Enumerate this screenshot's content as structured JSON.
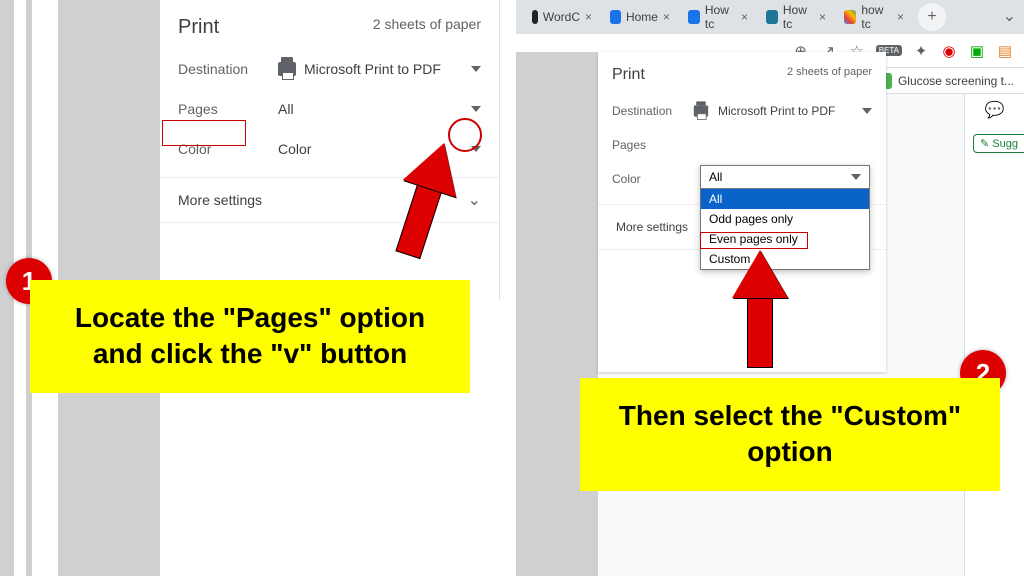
{
  "panel1": {
    "title": "Print",
    "sheets": "2 sheets of paper",
    "destination_label": "Destination",
    "destination_value": "Microsoft Print to PDF",
    "pages_label": "Pages",
    "pages_value": "All",
    "color_label": "Color",
    "color_value": "Color",
    "more_settings": "More settings"
  },
  "panel2": {
    "title": "Print",
    "sheets": "2 sheets of paper",
    "destination_label": "Destination",
    "destination_value": "Microsoft Print to PDF",
    "pages_label": "Pages",
    "pages_value": "All",
    "color_label": "Color",
    "more_settings": "More settings",
    "options": {
      "all": "All",
      "odd": "Odd pages only",
      "even": "Even pages only",
      "custom": "Custom"
    }
  },
  "tabs": {
    "t1": "WordC",
    "t2": "Home",
    "t3": "How tc",
    "t4": "How tc",
    "t5": "how tc"
  },
  "bookmark": {
    "label": "Glucose screening t..."
  },
  "suggest": "Sugg",
  "callout1": "Locate the \"Pages\" option and click the \"v\" button",
  "callout2": "Then select the \"Custom\" option",
  "badge1": "1",
  "badge2": "2",
  "newtab": "+",
  "close": "×"
}
